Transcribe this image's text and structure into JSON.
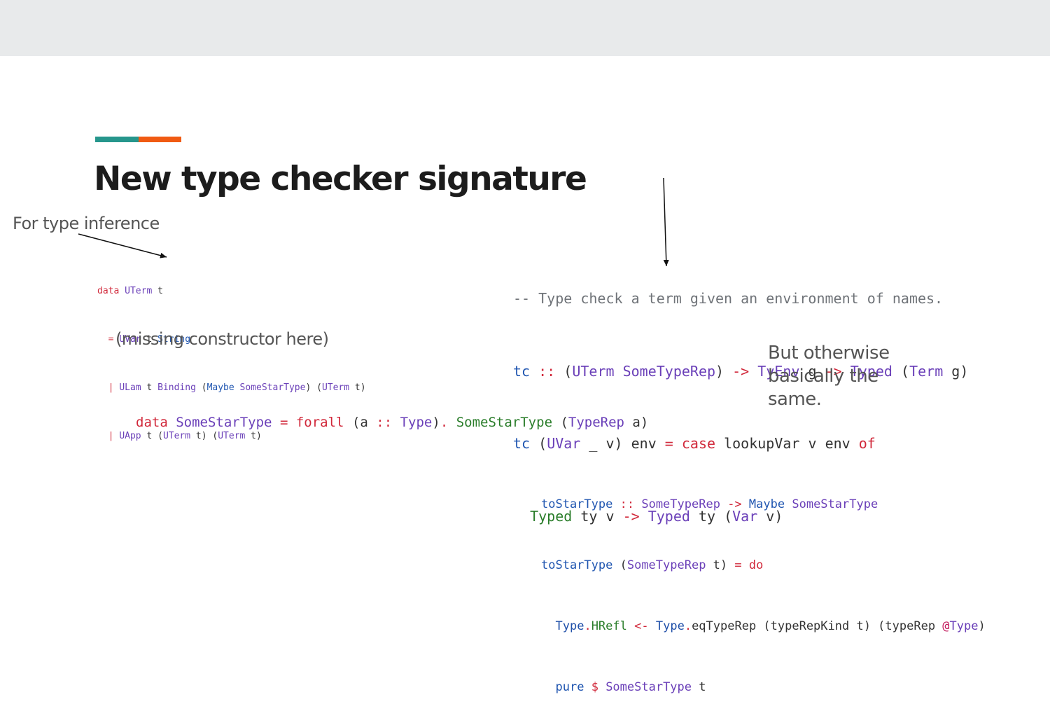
{
  "slide": {
    "title": "New type checker signature",
    "accent_colors": [
      "#26968c",
      "#f05a12"
    ],
    "notes": {
      "for_type_inference": "For type inference",
      "missing_constructor": "(missing constructor here)",
      "but_otherwise": [
        "But otherwise",
        "basically the",
        "same."
      ]
    }
  },
  "code": {
    "uterm": [
      "data UTerm t",
      "  = UVar t String",
      "  | ULam t Binding (Maybe SomeStarType) (UTerm t)",
      "  | UApp t (UTerm t) (UTerm t)"
    ],
    "tc": [
      "-- Type check a term given an environment of names.",
      "tc :: (UTerm SomeTypeRep) -> TyEnv g -> Typed (Term g)",
      "tc (UVar _ v) env = case lookupVar v env of",
      "  Typed ty v -> Typed ty (Var v)"
    ],
    "some_star_type": "data SomeStarType = forall (a :: Type). SomeStarType (TypeRep a)",
    "to_star_type": [
      "toStarType :: SomeTypeRep -> Maybe SomeStarType",
      "toStarType (SomeTypeRep t) = do",
      "  Type.HRefl <- Type.eqTypeRep (typeRepKind t) (typeRep @Type)",
      "  pure $ SomeStarType t"
    ]
  }
}
